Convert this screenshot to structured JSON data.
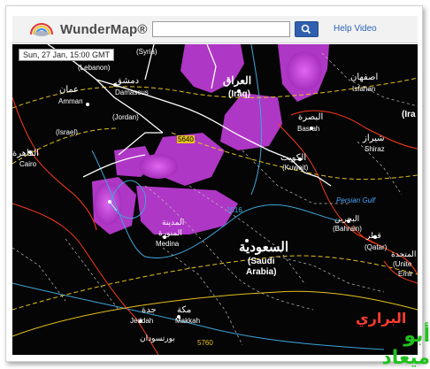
{
  "header": {
    "brand": "WunderMap®",
    "search_value": "",
    "help_link": "Help Video",
    "logo_icon": "cloud-rainbow-icon",
    "search_icon": "magnifier-icon"
  },
  "map": {
    "timestamp": "Sun, 27 Jan, 15:00 GMT",
    "labels": {
      "syria": "(Syria)",
      "lebanon": "(Lebanon)",
      "damascus_ar": "دمشق",
      "damascus": "Damascus",
      "amman_ar": "عمان",
      "amman": "Amman",
      "jordan": "(Jordan)",
      "israel": "(Israel)",
      "cairo_ar": "القاهرة",
      "cairo": "Cairo",
      "iraq_ar": "العراق",
      "iraq": "(Iraq)",
      "basrah_ar": "البصرة",
      "basrah": "Basrah",
      "kuwait_ar": "الكويت",
      "kuwait": "(Kuwait)",
      "isfahan_ar": "اصفهان",
      "isfahan": "Isfahan",
      "shiraz_ar": "شيراز",
      "shiraz": "Shiraz",
      "iran": "(Ira",
      "persian_gulf": "Persian Gulf",
      "bahrain_ar": "البحرين",
      "bahrain": "(Bahrain)",
      "qatar_ar": "قطر",
      "qatar": "(Qatar)",
      "uae_ar": "المتحدة",
      "uae": "(Unite",
      "emir": "Emir",
      "saudi_ar": "السعودية",
      "saudi": "(Saudi",
      "arabia": "Arabia)",
      "medina_ar": "المدينة",
      "medina_ar2": "المنورة",
      "medina": "Medina",
      "jeddah_ar": "جدة",
      "jeddah": "Jeddah",
      "makkah_ar": "مكة",
      "makkah": "Makkah",
      "port_sudan_ar": "بورتسودان"
    },
    "isobars": {
      "a": "5640",
      "b": "1016",
      "c": "5760"
    },
    "colors": {
      "precip": "#c53bd8",
      "precip_core": "#e066f0",
      "border": "#ffffff",
      "coast": "#ff3a1a",
      "isobar_blue": "#3ea6d9",
      "jet_yellow": "#e6c21b",
      "isobar_label_bg": "#e6c21b"
    }
  },
  "credit": {
    "line1": "البراري",
    "line2": "أبو ميعاد"
  }
}
